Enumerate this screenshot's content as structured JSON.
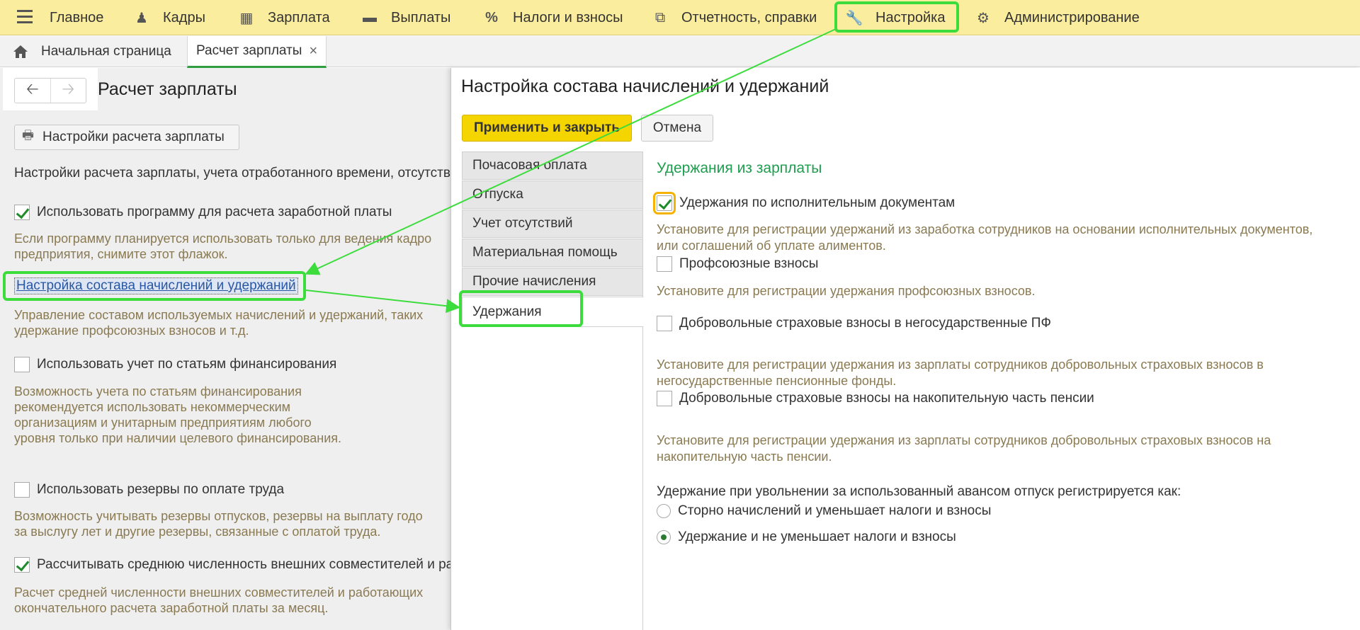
{
  "menu": {
    "items": [
      {
        "label": "Главное",
        "icon": "hamburger-icon"
      },
      {
        "label": "Кадры",
        "icon": "people-icon"
      },
      {
        "label": "Зарплата",
        "icon": "calculator-icon"
      },
      {
        "label": "Выплаты",
        "icon": "wallet-icon"
      },
      {
        "label": "Налоги и взносы",
        "icon": "percent-icon"
      },
      {
        "label": "Отчетность, справки",
        "icon": "reports-icon"
      },
      {
        "label": "Настройка",
        "icon": "wrench-icon"
      },
      {
        "label": "Администрирование",
        "icon": "gear-icon"
      }
    ]
  },
  "tabs": {
    "home": "Начальная страница",
    "current": "Расчет зарплаты",
    "close": "×"
  },
  "left": {
    "title": "Расчет зарплаты",
    "settings_button": "Настройки расчета зарплаты",
    "intro": "Настройки расчета зарплаты, учета отработанного времени, отсутств",
    "use_program": {
      "label": "Использовать программу для расчета заработной платы",
      "checked": true
    },
    "use_program_hint": "Если программу планируется использовать только для ведения кадро\nпредприятия, снимите этот флажок.",
    "link": "Настройка состава начислений и удержаний",
    "link_hint": "Управление составом используемых начислений и удержаний, таких\nудержание профсоюзных взносов и т.д.",
    "finance": {
      "label": "Использовать учет по статьям финансирования",
      "checked": false
    },
    "finance_hint": "Возможность учета по статьям финансирования\nрекомендуется использовать некоммерческим\nорганизациям и унитарным предприятиям любого\nуровня только при наличии целевого финансирования.",
    "reserves": {
      "label": "Использовать резервы по оплате труда",
      "checked": false
    },
    "reserves_hint": "Возможность учитывать резервы отпусков,  резервы на выплату годо\nза выслугу лет и другие резервы, связанные с оплатой труда.",
    "avg": {
      "label": "Рассчитывать среднюю численность внешних совместителей и ра",
      "checked": true
    },
    "avg_hint": "Расчет средней численности внешних совместителей и работающих \nокончательного расчета заработной платы за месяц."
  },
  "dialog": {
    "title": "Настройка состава начислений и удержаний",
    "apply": "Применить и закрыть",
    "cancel": "Отмена",
    "tabs": [
      "Почасовая оплата",
      "Отпуска",
      "Учет отсутствий",
      "Материальная помощь",
      "Прочие начисления",
      "Удержания"
    ],
    "active_tab": "Удержания",
    "section_title": "Удержания из зарплаты",
    "options": [
      {
        "label": "Удержания по исполнительным документам",
        "checked": true,
        "hint": "Установите для регистрации удержаний из заработка сотрудников на основании исполнительных документов,\nили соглашений об уплате алиментов."
      },
      {
        "label": "Профсоюзные взносы",
        "checked": false,
        "hint": "Установите для регистрации удержания профсоюзных взносов."
      },
      {
        "label": "Добровольные страховые взносы в негосударственные ПФ",
        "checked": false,
        "hint": "Установите для регистрации удержания из зарплаты сотрудников добровольных страховых взносов в\nнегосударственные пенсионные фонды."
      },
      {
        "label": "Добровольные страховые взносы на накопительную часть пенсии",
        "checked": false,
        "hint": "Установите для регистрации удержания из зарплаты сотрудников добровольных страховых взносов на\nнакопительную часть пенсии."
      }
    ],
    "radio_caption": "Удержание при увольнении за использованный авансом отпуск регистрируется как:",
    "radios": [
      {
        "label": "Сторно начислений и уменьшает налоги и взносы",
        "checked": false
      },
      {
        "label": "Удержание и не уменьшает налоги и взносы",
        "checked": true
      }
    ]
  },
  "colors": {
    "menu_bg": "#fbed9e",
    "highlight": "#3ddc3d",
    "apply_button": "#f5d500",
    "section_title": "#1e9e4e",
    "hint_text": "#8a7a52"
  }
}
